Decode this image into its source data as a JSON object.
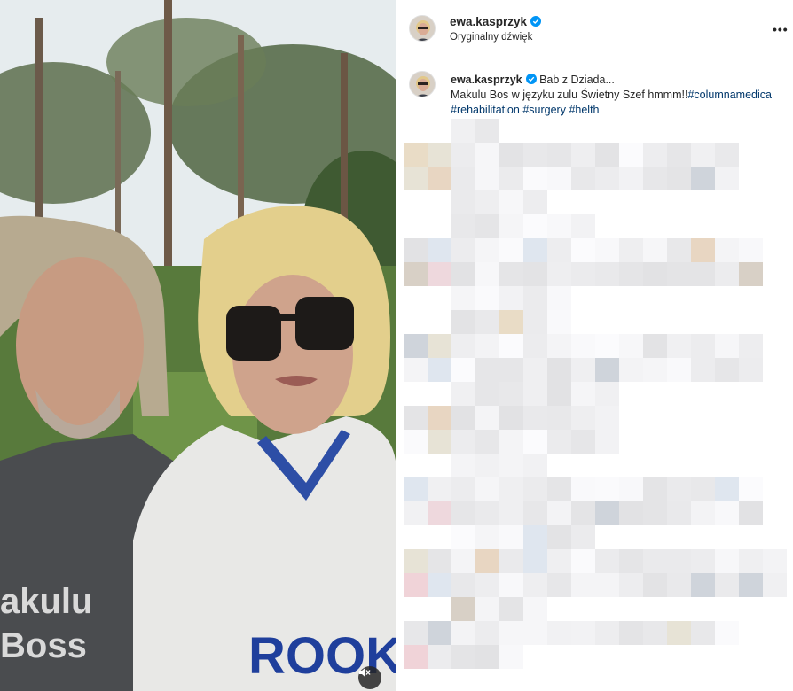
{
  "post": {
    "username": "ewa.kasprzyk",
    "audio_label": "Oryginalny dźwięk",
    "more_label": "•••"
  },
  "caption": {
    "username": "ewa.kasprzyk",
    "line1": "Bab z Dziada...",
    "line2_text": "Makulu Bos w języku zulu Świetny Szef hmmm!!",
    "hashtags": [
      "#columnamedica",
      "#rehabilitation",
      "#surgery",
      "#helth"
    ]
  },
  "media": {
    "shirt_text_line1": "akulu",
    "shirt_text_line2": "Boss",
    "sweater_text": "ROOKL",
    "mute_icon": "speaker-muted-icon"
  },
  "colors": {
    "verified": "#0095f6",
    "hashtag": "#00376b",
    "divider": "#efefef"
  }
}
